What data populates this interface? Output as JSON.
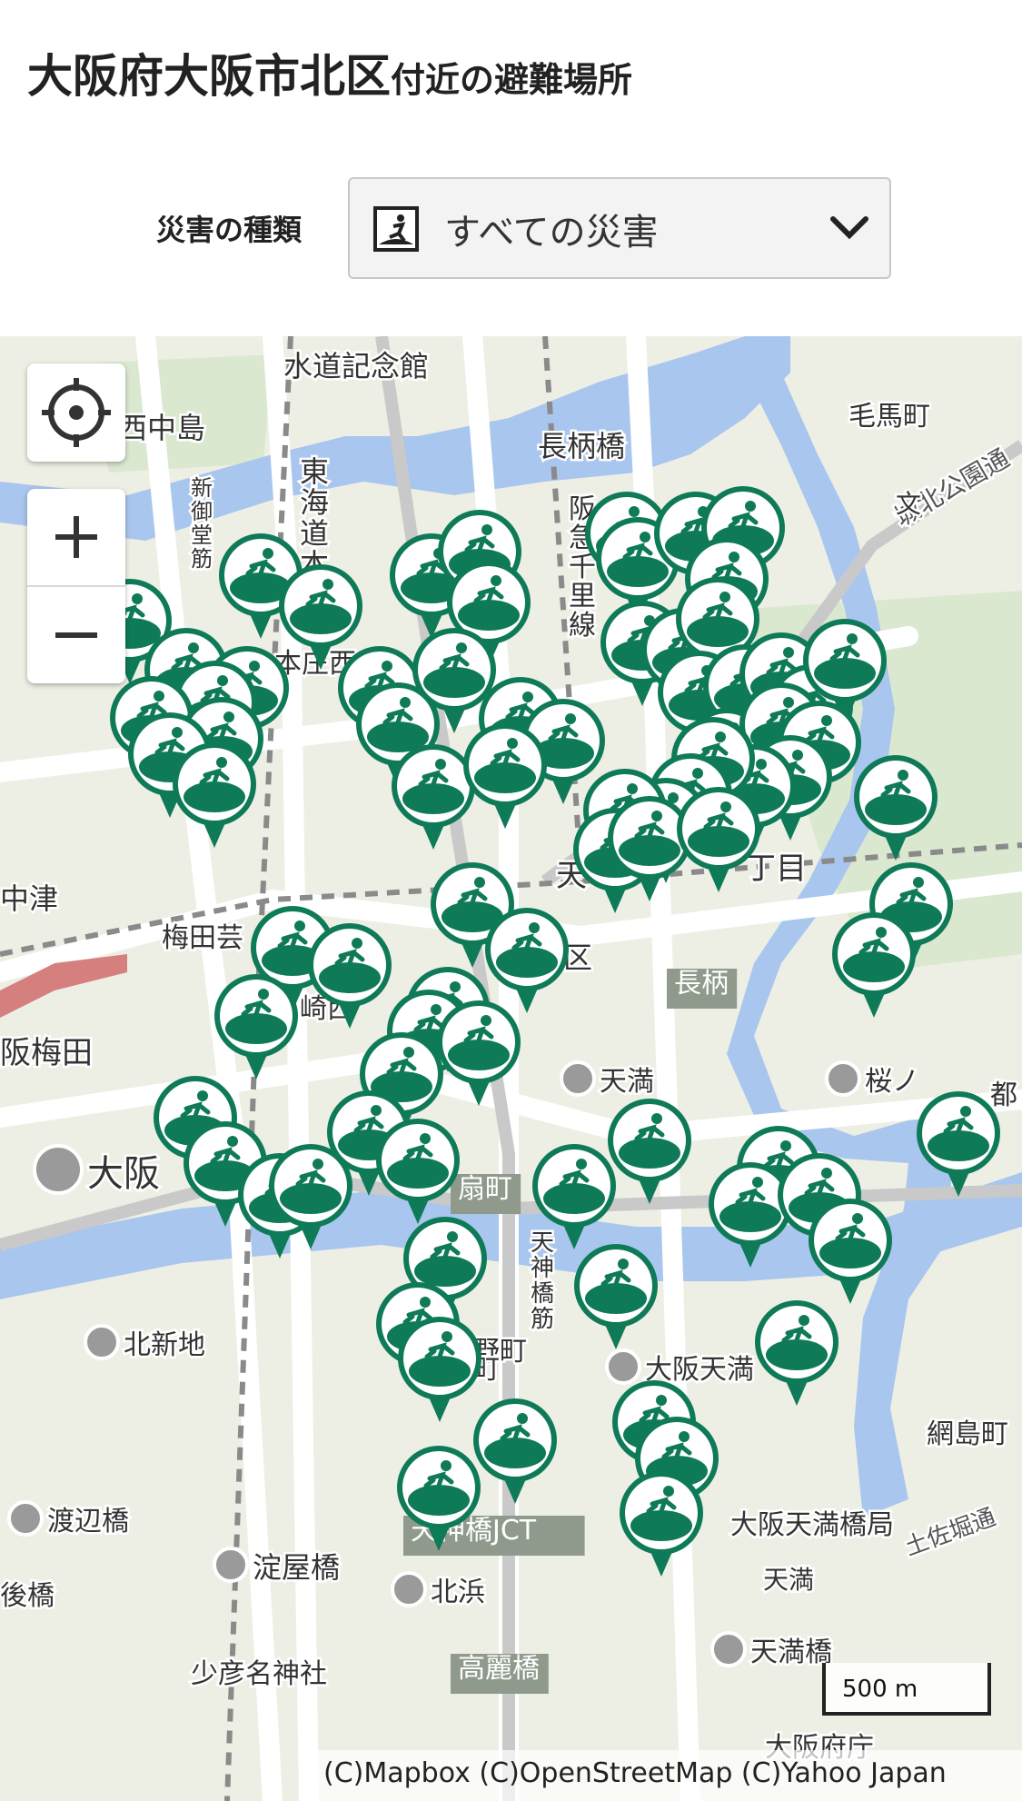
{
  "header": {
    "title_main": "大阪府大阪市北区",
    "title_sub": "付近の避難場所",
    "filter_label": "災害の種類",
    "select_value": "すべての災害",
    "select_icon": "disaster-icon"
  },
  "map": {
    "water_color": "#a9c6ee",
    "park_color": "#dbe8d0",
    "marker_color": "#0f7a58",
    "labels": [
      {
        "text": "水道記念館",
        "type": "place"
      },
      {
        "text": "西中島",
        "type": "place"
      },
      {
        "text": "長柄橋",
        "type": "place"
      },
      {
        "text": "毛馬町",
        "type": "place"
      },
      {
        "text": "城北公園通",
        "type": "road"
      },
      {
        "text": "東海道本",
        "type": "rail"
      },
      {
        "text": "新御堂筋",
        "type": "road"
      },
      {
        "text": "阪急千里線",
        "type": "rail"
      },
      {
        "text": "本庄西",
        "type": "place"
      },
      {
        "text": "中津",
        "type": "place"
      },
      {
        "text": "梅田芸",
        "type": "place"
      },
      {
        "text": "崎西",
        "type": "place"
      },
      {
        "text": "区",
        "type": "place"
      },
      {
        "text": "丁目",
        "type": "place"
      },
      {
        "text": "天",
        "type": "place"
      },
      {
        "text": "長柄",
        "type": "road_badge"
      },
      {
        "text": "阪梅田",
        "type": "station"
      },
      {
        "text": "天満",
        "type": "station"
      },
      {
        "text": "桜ノ",
        "type": "station"
      },
      {
        "text": "都",
        "type": "place"
      },
      {
        "text": "大阪",
        "type": "station_major"
      },
      {
        "text": "扇町",
        "type": "road_badge"
      },
      {
        "text": "天神橋筋",
        "type": "road"
      },
      {
        "text": "野町",
        "type": "place"
      },
      {
        "text": "北新地",
        "type": "station"
      },
      {
        "text": "町",
        "type": "station"
      },
      {
        "text": "大阪天満",
        "type": "station"
      },
      {
        "text": "網島町",
        "type": "place"
      },
      {
        "text": "渡辺橋",
        "type": "station"
      },
      {
        "text": "天神橋JCT",
        "type": "road_badge"
      },
      {
        "text": "大阪天満橋局",
        "type": "place"
      },
      {
        "text": "淀屋橋",
        "type": "station"
      },
      {
        "text": "北浜",
        "type": "station"
      },
      {
        "text": "後橋",
        "type": "station"
      },
      {
        "text": "天満",
        "type": "place"
      },
      {
        "text": "土佐堀通",
        "type": "road"
      },
      {
        "text": "天満橋",
        "type": "station"
      },
      {
        "text": "少彦名神社",
        "type": "place"
      },
      {
        "text": "高麗橋",
        "type": "road_badge"
      },
      {
        "text": "大阪府庁",
        "type": "place"
      },
      {
        "text": "文",
        "type": "symbol"
      }
    ],
    "scale_label": "500 m",
    "attribution": "(C)Mapbox (C)OpenStreetMap (C)Yahoo Japan"
  }
}
